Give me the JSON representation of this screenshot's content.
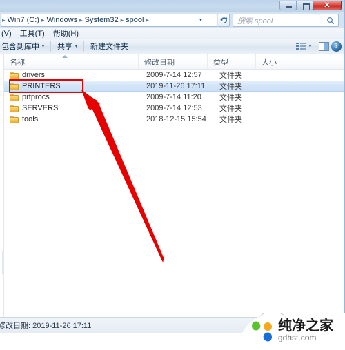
{
  "window": {
    "buttons": {
      "minimize": "–",
      "maximize": "□",
      "close": "✕"
    }
  },
  "address": {
    "crumbs": [
      "Win7 (C:)",
      "Windows",
      "System32",
      "spool"
    ],
    "separator": "▸",
    "dropdown_caret": "▼",
    "refresh_label": "↻"
  },
  "search": {
    "placeholder": "搜索 spool"
  },
  "menu": {
    "items": [
      "(V)",
      "工具(T)",
      "帮助(H)"
    ]
  },
  "toolbar": {
    "include_in_library": "包含到库中",
    "share": "共享",
    "new_folder": "新建文件夹",
    "caret": "▾",
    "help_glyph": "?"
  },
  "columns": {
    "name": "名称",
    "date_modified": "修改日期",
    "type": "类型",
    "size": "大小"
  },
  "files": [
    {
      "name": "drivers",
      "date": "2009-7-14 12:57",
      "type": "文件夹",
      "size": "",
      "selected": false
    },
    {
      "name": "PRINTERS",
      "date": "2019-11-26 17:11",
      "type": "文件夹",
      "size": "",
      "selected": true
    },
    {
      "name": "prtprocs",
      "date": "2009-7-14 11:20",
      "type": "文件夹",
      "size": "",
      "selected": false
    },
    {
      "name": "SERVERS",
      "date": "2009-7-14 12:53",
      "type": "文件夹",
      "size": "",
      "selected": false
    },
    {
      "name": "tools",
      "date": "2018-12-15 15:54",
      "type": "文件夹",
      "size": "",
      "selected": false
    }
  ],
  "status": {
    "text": "修改日期: 2019-11-26 17:11"
  },
  "watermark": {
    "name_cn": "纯净之家",
    "domain": "gdhst.com"
  },
  "colors": {
    "annotation_red": "#e60000",
    "selection_blue": "#cbe0f7",
    "folder_yellow": "#f6c960",
    "close_red": "#c42a22",
    "logo_green": "#5cc22e",
    "logo_yellow": "#f5a81c",
    "logo_blue": "#1a6fd4"
  }
}
